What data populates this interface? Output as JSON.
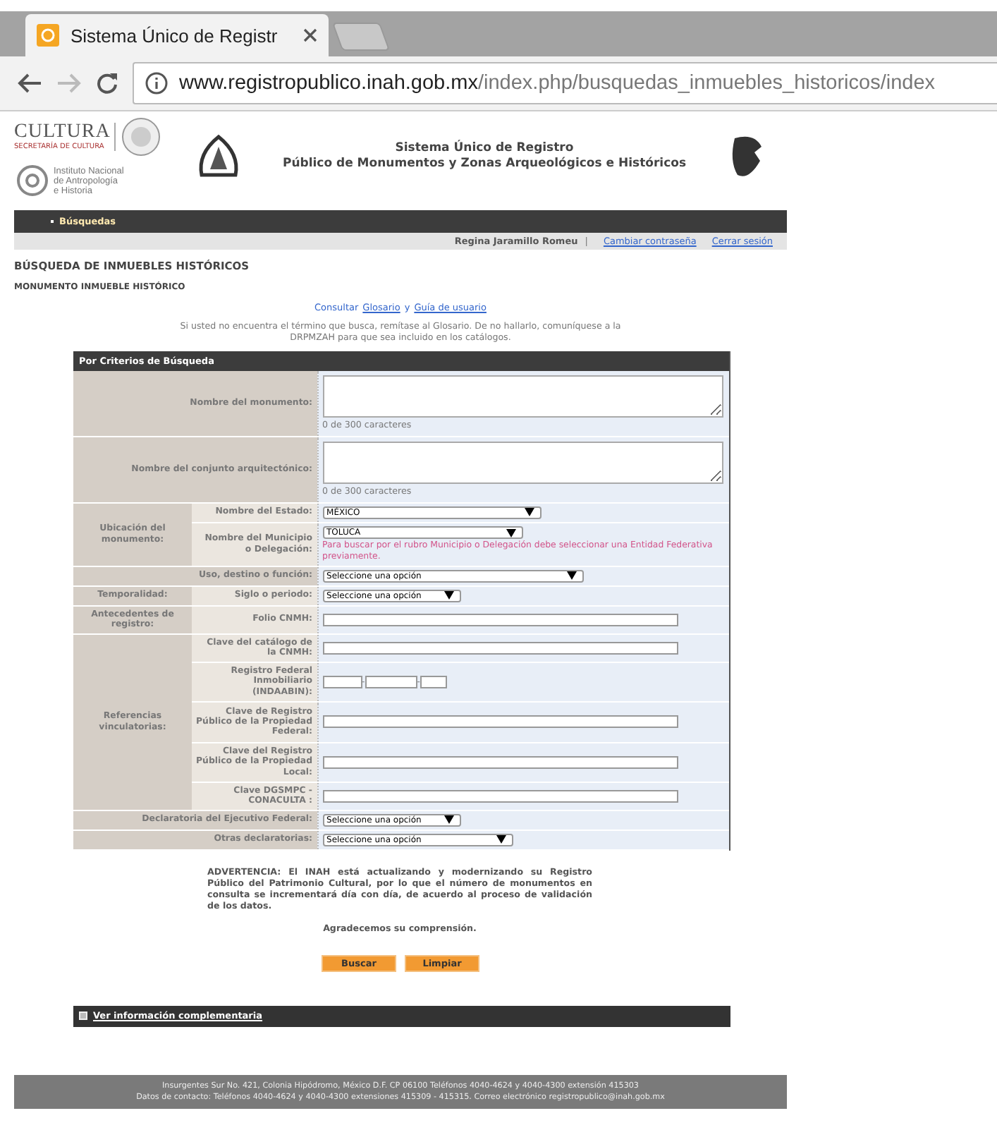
{
  "browser": {
    "tab_title": "Sistema Único de Registr",
    "url_host": "www.registropublico.inah.gob.mx",
    "url_path": "/index.php/busquedas_inmuebles_historicos/index"
  },
  "header": {
    "cultura": "CULTURA",
    "secretaria": "SECRETARÍA DE CULTURA",
    "inah_lines": [
      "Instituto Nacional",
      "de Antropología",
      "e Historia"
    ],
    "title_lines": [
      "Sistema Único de Registro",
      "Público de Monumentos y Zonas Arqueológicos e Históricos"
    ]
  },
  "nav": {
    "items": [
      {
        "label": "Búsquedas",
        "selected": true
      }
    ]
  },
  "user_bar": {
    "user": "Regina Jaramillo Romeu",
    "separator": "|",
    "links": [
      "Cambiar contraseña",
      "Cerrar sesión"
    ]
  },
  "heading": "BÚSQUEDA DE INMUEBLES HISTÓRICOS",
  "subheading": "MONUMENTO INMUEBLE HISTÓRICO",
  "consult": {
    "prefix": "Consultar",
    "link1": "Glosario",
    "joiner": "y",
    "link2": "Guía de usuario"
  },
  "notice": "Si usted no encuentra el término que busca, remítase al Glosario. De no hallarlo, comuníquese a la DRPMZAH para que sea incluido en los catálogos.",
  "form": {
    "title": "Por Criterios de Búsqueda",
    "rows": [
      {
        "kind": "textarea",
        "label": "Nombre del monumento:",
        "counter": "0 de 300 caracteres"
      },
      {
        "kind": "textarea",
        "label": "Nombre del conjunto arquitectónico:",
        "counter": "0 de 300 caracteres"
      },
      {
        "kind": "group",
        "label": "Ubicación del monumento:",
        "children": [
          {
            "label": "Nombre del Estado:",
            "field": {
              "kind": "select",
              "value": "MÉXICO"
            }
          },
          {
            "label": "Nombre del Municipio o Delegación:",
            "field": {
              "kind": "select",
              "value": "TOLUCA"
            },
            "hint": "Para buscar por el rubro Municipio o Delegación debe seleccionar una Entidad Federativa previamente."
          }
        ]
      },
      {
        "kind": "single",
        "label": "Uso, destino o función:",
        "field": {
          "kind": "select",
          "value": "Seleccione una opción"
        }
      },
      {
        "kind": "group",
        "label": "Temporalidad:",
        "children": [
          {
            "label": "Siglo o periodo:",
            "field": {
              "kind": "select",
              "value": "Seleccione una opción"
            }
          }
        ]
      },
      {
        "kind": "group",
        "label": "Antecedentes de registro:",
        "children": [
          {
            "label": "Folio CNMH:",
            "field": {
              "kind": "text"
            }
          }
        ]
      },
      {
        "kind": "group",
        "label": "Referencias vinculatorias:",
        "children": [
          {
            "label": "Clave del catálogo de la CNMH:",
            "field": {
              "kind": "text"
            }
          },
          {
            "label": "Registro Federal Inmobiliario (INDAABIN):",
            "field": {
              "kind": "triple",
              "separators": [
                "-",
                "-"
              ]
            }
          },
          {
            "label": "Clave de Registro Público de la Propiedad Federal:",
            "field": {
              "kind": "text"
            }
          },
          {
            "label": "Clave del Registro Público de la Propiedad Local:",
            "field": {
              "kind": "text"
            }
          },
          {
            "label": "Clave DGSMPC - CONACULTA :",
            "field": {
              "kind": "text"
            }
          }
        ]
      },
      {
        "kind": "single",
        "label": "Declaratoria del Ejecutivo Federal:",
        "field": {
          "kind": "select",
          "value": "Seleccione una opción"
        }
      },
      {
        "kind": "single",
        "label": "Otras declaratorias:",
        "field": {
          "kind": "select",
          "value": "Seleccione una opción"
        }
      }
    ]
  },
  "warning": "ADVERTENCIA: El INAH está actualizando y modernizando su Registro Público del Patrimonio Cultural, por lo que el número de monumentos en consulta se incrementará día con día, de acuerdo al proceso de validación de los datos.",
  "thanks": "Agradecemos su comprensión.",
  "buttons": [
    "Buscar",
    "Limpiar"
  ],
  "more_info": {
    "label": "Ver información complementaria",
    "expanded": false
  },
  "footer": [
    "Insurgentes Sur No. 421, Colonia Hipódromo, México D.F. CP 06100 Teléfonos 4040-4624 y 4040-4300 extensión 415303",
    "Datos de contacto: Teléfonos 4040-4624 y 4040-4300 extensiones 415309 - 415315. Correo electrónico registropublico@inah.gob.mx"
  ]
}
